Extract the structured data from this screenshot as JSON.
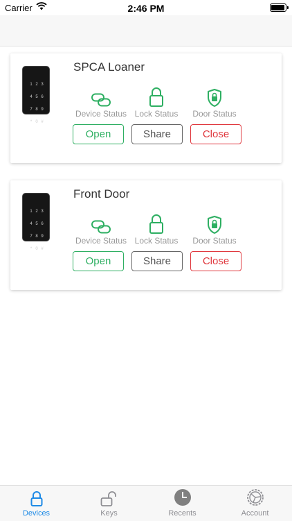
{
  "status_bar": {
    "carrier": "Carrier",
    "time": "2:46 PM"
  },
  "devices": [
    {
      "name": "SPCA Loaner",
      "statuses": [
        {
          "label": "Device Status",
          "icon": "link-icon"
        },
        {
          "label": "Lock Status",
          "icon": "lock-icon"
        },
        {
          "label": "Door Status",
          "icon": "shield-lock-icon"
        }
      ],
      "actions": {
        "open": "Open",
        "share": "Share",
        "close": "Close"
      }
    },
    {
      "name": "Front Door",
      "statuses": [
        {
          "label": "Device Status",
          "icon": "link-icon"
        },
        {
          "label": "Lock Status",
          "icon": "lock-icon"
        },
        {
          "label": "Door Status",
          "icon": "shield-lock-icon"
        }
      ],
      "actions": {
        "open": "Open",
        "share": "Share",
        "close": "Close"
      }
    }
  ],
  "keypad_keys": [
    "1",
    "2",
    "3",
    "4",
    "5",
    "6",
    "7",
    "8",
    "9",
    "*",
    "0",
    "#"
  ],
  "tabs": [
    {
      "label": "Devices",
      "icon": "lock-icon",
      "active": true
    },
    {
      "label": "Keys",
      "icon": "unlock-icon",
      "active": false
    },
    {
      "label": "Recents",
      "icon": "clock-icon",
      "active": false
    },
    {
      "label": "Account",
      "icon": "settings-icon",
      "active": false
    }
  ],
  "colors": {
    "accent": "#2eaf62",
    "danger": "#e0383e",
    "tab_active": "#1e8ae6",
    "tab_inactive": "#8e8e93"
  }
}
